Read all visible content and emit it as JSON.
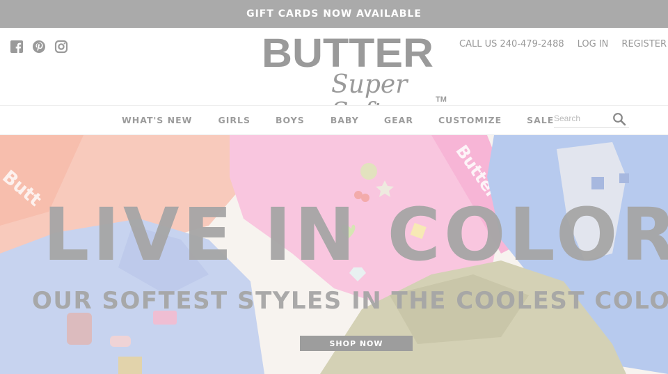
{
  "announcement": {
    "text": "GIFT CARDS NOW AVAILABLE"
  },
  "social": {
    "icons": [
      "facebook-icon",
      "pinterest-icon",
      "instagram-icon"
    ]
  },
  "logo": {
    "top": "BUTTER",
    "bottom": "Super Soft",
    "tm": "TM"
  },
  "utility": {
    "call": "CALL US 240-479-2488",
    "login": "LOG IN",
    "register": "REGISTER"
  },
  "nav": {
    "items": [
      "WHAT'S NEW",
      "GIRLS",
      "BOYS",
      "BABY",
      "GEAR",
      "CUSTOMIZE",
      "SALE"
    ]
  },
  "search": {
    "placeholder": "Search"
  },
  "hero": {
    "headline": "LIVE IN COLOR",
    "subline": "OUR SOFTEST STYLES IN THE COOLEST COLORS",
    "cta": "SHOP NOW"
  },
  "colors": {
    "announcement_bg": "#aaaaaa",
    "text_gray": "#9c9c9c",
    "cta_bg": "#9d9d9d"
  }
}
